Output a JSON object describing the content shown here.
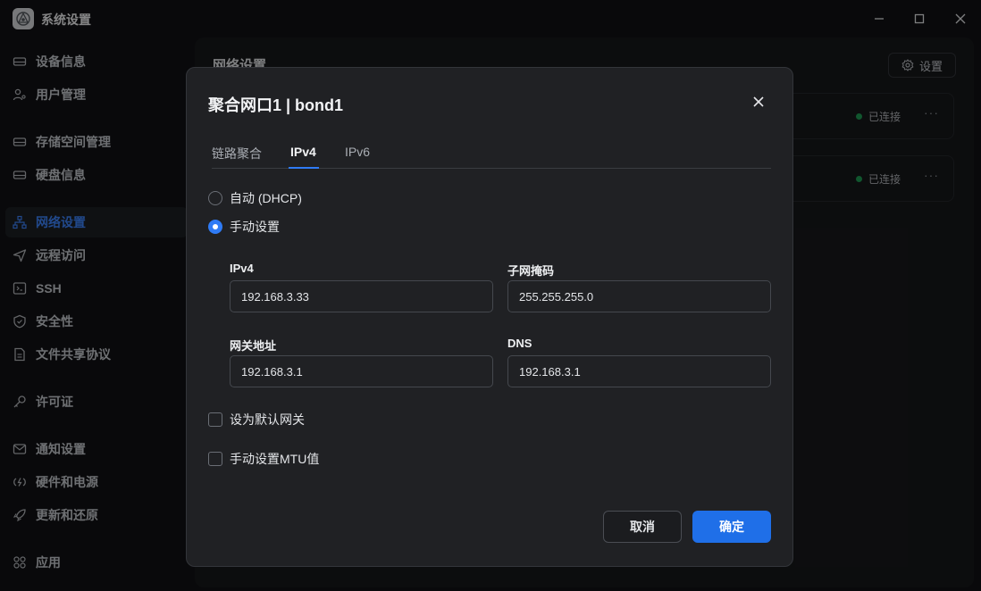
{
  "window": {
    "title": "系统设置"
  },
  "sidebar": {
    "items": [
      {
        "label": "设备信息",
        "icon": "device-icon"
      },
      {
        "label": "用户管理",
        "icon": "user-icon"
      },
      {
        "label": "存储空间管理",
        "icon": "storage-icon"
      },
      {
        "label": "硬盘信息",
        "icon": "disk-icon"
      },
      {
        "label": "网络设置",
        "icon": "network-icon",
        "active": true
      },
      {
        "label": "远程访问",
        "icon": "send-icon"
      },
      {
        "label": "SSH",
        "icon": "terminal-icon"
      },
      {
        "label": "安全性",
        "icon": "shield-icon"
      },
      {
        "label": "文件共享协议",
        "icon": "document-icon"
      },
      {
        "label": "许可证",
        "icon": "key-icon"
      },
      {
        "label": "通知设置",
        "icon": "mail-icon"
      },
      {
        "label": "硬件和电源",
        "icon": "power-icon"
      },
      {
        "label": "更新和还原",
        "icon": "rocket-icon"
      },
      {
        "label": "应用",
        "icon": "apps-icon"
      }
    ]
  },
  "main": {
    "title": "网络设置",
    "settings_label": "设置",
    "cards": [
      {
        "status": "已连接",
        "more": "···"
      },
      {
        "status": "已连接",
        "more": "···"
      }
    ]
  },
  "dialog": {
    "title": "聚合网口1 | bond1",
    "tabs": [
      {
        "label": "链路聚合"
      },
      {
        "label": "IPv4",
        "active": true
      },
      {
        "label": "IPv6"
      }
    ],
    "mode_options": [
      {
        "label": "自动 (DHCP)",
        "checked": false
      },
      {
        "label": "手动设置",
        "checked": true
      }
    ],
    "fields": {
      "ipv4": {
        "label": "IPv4",
        "value": "192.168.3.33"
      },
      "subnet": {
        "label": "子网掩码",
        "value": "255.255.255.0"
      },
      "gateway": {
        "label": "网关地址",
        "value": "192.168.3.1"
      },
      "dns": {
        "label": "DNS",
        "value": "192.168.3.1"
      }
    },
    "checkboxes": [
      {
        "label": "设为默认网关",
        "checked": false
      },
      {
        "label": "手动设置MTU值",
        "checked": false
      }
    ],
    "cancel_label": "取消",
    "ok_label": "确定"
  },
  "colors": {
    "accent": "#2f7bf5",
    "primary_button": "#1f6fe8",
    "status_connected": "#1f9d55"
  }
}
